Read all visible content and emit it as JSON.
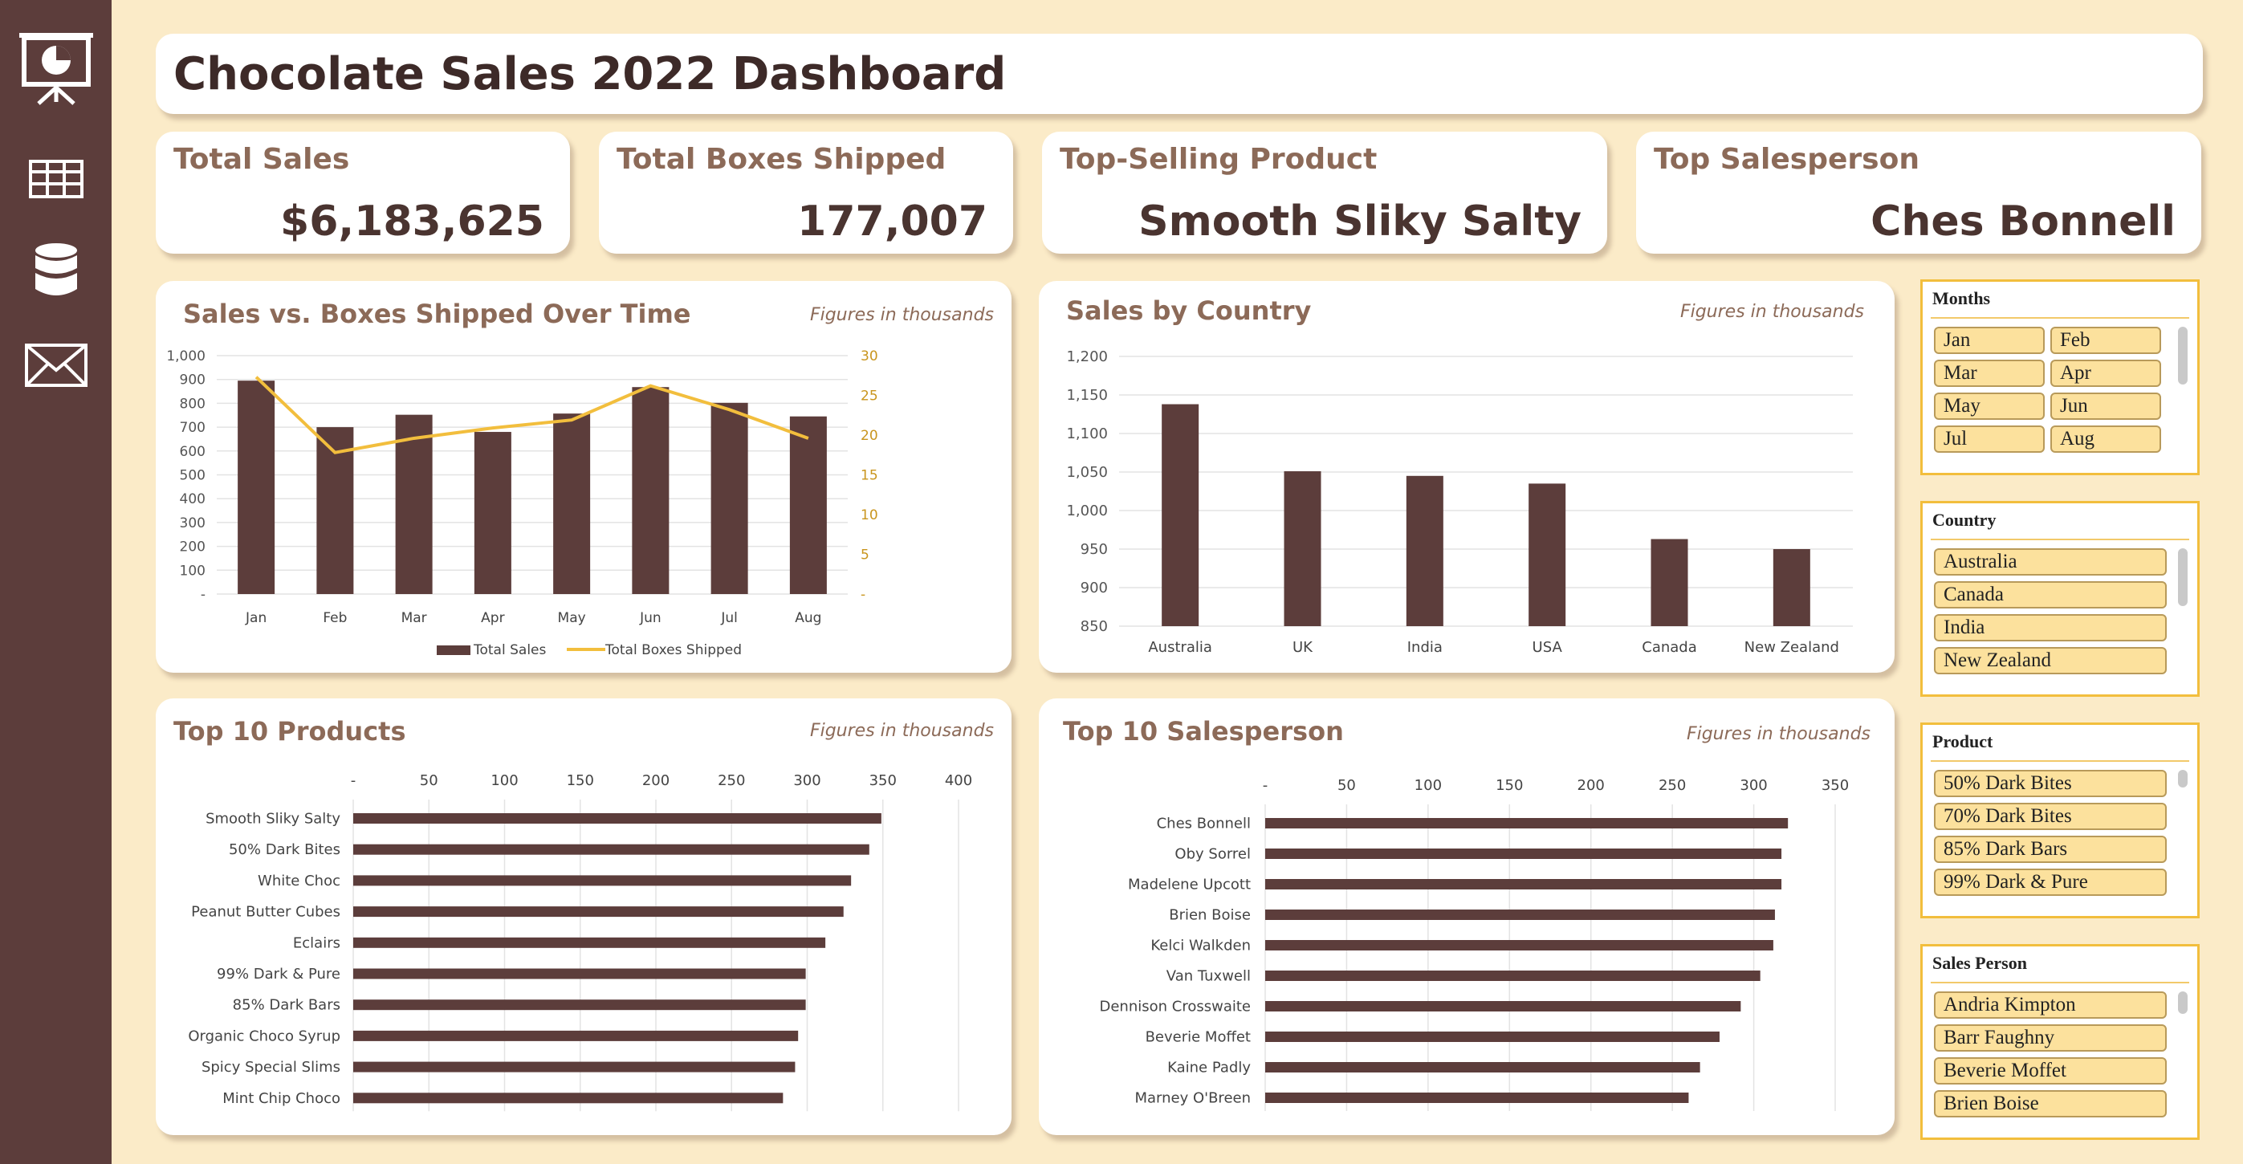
{
  "nav": {
    "items": [
      {
        "name": "presentation-chart-icon"
      },
      {
        "name": "table-grid-icon"
      },
      {
        "name": "database-icon"
      },
      {
        "name": "envelope-icon"
      }
    ]
  },
  "header": {
    "title": "Chocolate Sales 2022 Dashboard"
  },
  "kpis": {
    "total_sales": {
      "label": "Total Sales",
      "value": "$6,183,625"
    },
    "total_boxes": {
      "label": "Total Boxes Shipped",
      "value": "177,007"
    },
    "top_product": {
      "label": "Top-Selling Product",
      "value": "Smooth Sliky Salty"
    },
    "top_salesperson": {
      "label": "Top Salesperson",
      "value": "Ches Bonnell"
    }
  },
  "colors": {
    "bar": "#5C3D3B",
    "line": "#F2BE3D",
    "accent_text": "#8C6A58",
    "background": "#FBEBC8",
    "slicer_item": "#FCE19D"
  },
  "chart_data": [
    {
      "id": "sales-vs-boxes",
      "type": "bar",
      "title": "Sales vs. Boxes Shipped Over Time",
      "note": "Figures in thousands",
      "categories": [
        "Jan",
        "Feb",
        "Mar",
        "Apr",
        "May",
        "Jun",
        "Jul",
        "Aug"
      ],
      "series": [
        {
          "name": "Total Sales",
          "type": "bar",
          "axis": "left",
          "values": [
            895,
            700,
            752,
            680,
            757,
            868,
            802,
            745
          ]
        },
        {
          "name": "Total Boxes Shipped",
          "type": "line",
          "axis": "right",
          "values": [
            27.3,
            17.8,
            19.6,
            20.9,
            21.9,
            26.2,
            23.2,
            19.6
          ]
        }
      ],
      "ylim": [
        0,
        1000
      ],
      "yticks": [
        "-",
        "100",
        "200",
        "300",
        "400",
        "500",
        "600",
        "700",
        "800",
        "900",
        "1,000"
      ],
      "y2lim": [
        0,
        30
      ],
      "y2ticks": [
        "-",
        "5",
        "10",
        "15",
        "20",
        "25",
        "30"
      ],
      "legend": "bottom",
      "grid": true
    },
    {
      "id": "sales-by-country",
      "type": "bar",
      "title": "Sales by Country",
      "note": "Figures in thousands",
      "categories": [
        "Australia",
        "UK",
        "India",
        "USA",
        "Canada",
        "New Zealand"
      ],
      "values": [
        1138,
        1051,
        1045,
        1035,
        963,
        950
      ],
      "ylim": [
        850,
        1200
      ],
      "yticks": [
        "850",
        "900",
        "950",
        "1,000",
        "1,050",
        "1,100",
        "1,150",
        "1,200"
      ],
      "grid": true
    },
    {
      "id": "top-products",
      "type": "bar",
      "orientation": "horizontal",
      "title": "Top 10 Products",
      "note": "Figures in thousands",
      "categories": [
        "Smooth Sliky Salty",
        "50% Dark Bites",
        "White Choc",
        "Peanut Butter Cubes",
        "Eclairs",
        "99% Dark & Pure",
        "85% Dark Bars",
        "Organic Choco Syrup",
        "Spicy Special Slims",
        "Mint Chip Choco"
      ],
      "values": [
        349,
        341,
        329,
        324,
        312,
        299,
        299,
        294,
        292,
        284
      ],
      "xlim": [
        0,
        400
      ],
      "xticks": [
        "-",
        "50",
        "100",
        "150",
        "200",
        "250",
        "300",
        "350",
        "400"
      ],
      "grid": true
    },
    {
      "id": "top-salesperson",
      "type": "bar",
      "orientation": "horizontal",
      "title": "Top 10 Salesperson",
      "note": "Figures in thousands",
      "categories": [
        "Ches Bonnell",
        "Oby Sorrel",
        "Madelene Upcott",
        "Brien Boise",
        "Kelci Walkden",
        "Van Tuxwell",
        "Dennison Crosswaite",
        "Beverie Moffet",
        "Kaine Padly",
        "Marney O'Breen"
      ],
      "values": [
        321,
        317,
        317,
        313,
        312,
        304,
        292,
        279,
        267,
        260
      ],
      "xlim": [
        0,
        350
      ],
      "xticks": [
        "-",
        "50",
        "100",
        "150",
        "200",
        "250",
        "300",
        "350"
      ],
      "grid": true
    }
  ],
  "slicers": {
    "months": {
      "title": "Months",
      "items": [
        "Jan",
        "Feb",
        "Mar",
        "Apr",
        "May",
        "Jun",
        "Jul",
        "Aug"
      ]
    },
    "country": {
      "title": "Country",
      "items": [
        "Australia",
        "Canada",
        "India",
        "New Zealand"
      ]
    },
    "product": {
      "title": "Product",
      "items": [
        "50% Dark Bites",
        "70% Dark Bites",
        "85% Dark Bars",
        "99% Dark & Pure"
      ]
    },
    "sales_person": {
      "title": "Sales Person",
      "items": [
        "Andria Kimpton",
        "Barr Faughny",
        "Beverie Moffet",
        "Brien Boise"
      ]
    }
  }
}
